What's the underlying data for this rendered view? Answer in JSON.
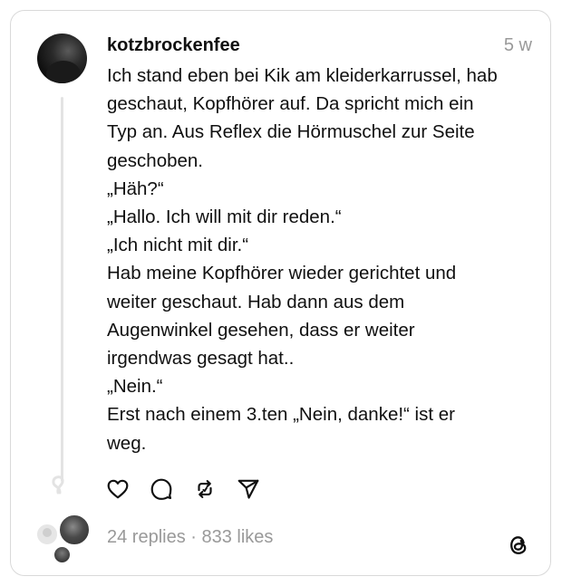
{
  "post": {
    "username": "kotzbrockenfee",
    "timestamp": "5 w",
    "lines": [
      "Ich stand eben bei Kik am kleiderkarrussel, hab",
      "geschaut, Kopfhörer auf. Da spricht mich ein",
      "Typ an. Aus Reflex die Hörmuschel zur Seite",
      "geschoben.",
      "„Häh?“",
      "„Hallo. Ich will mit dir reden.“",
      "„Ich nicht mit dir.“",
      "Hab meine Kopfhörer wieder gerichtet und",
      "weiter geschaut. Hab dann aus dem",
      "Augenwinkel gesehen, dass er weiter",
      "irgendwas gesagt hat..",
      "„Nein.“",
      "Erst nach einem 3.ten „Nein, danke!“ ist er",
      "weg."
    ]
  },
  "actions": {
    "like_icon": "heart-icon",
    "reply_icon": "comment-icon",
    "repost_icon": "repost-icon",
    "share_icon": "send-icon"
  },
  "stats": {
    "text": "24 replies · 833 likes"
  },
  "footer": {
    "logo_icon": "threads-logo-icon"
  },
  "colors": {
    "text": "#101010",
    "muted": "#999999",
    "border": "#d9d9d9",
    "thread_line": "#e3e3e3"
  }
}
